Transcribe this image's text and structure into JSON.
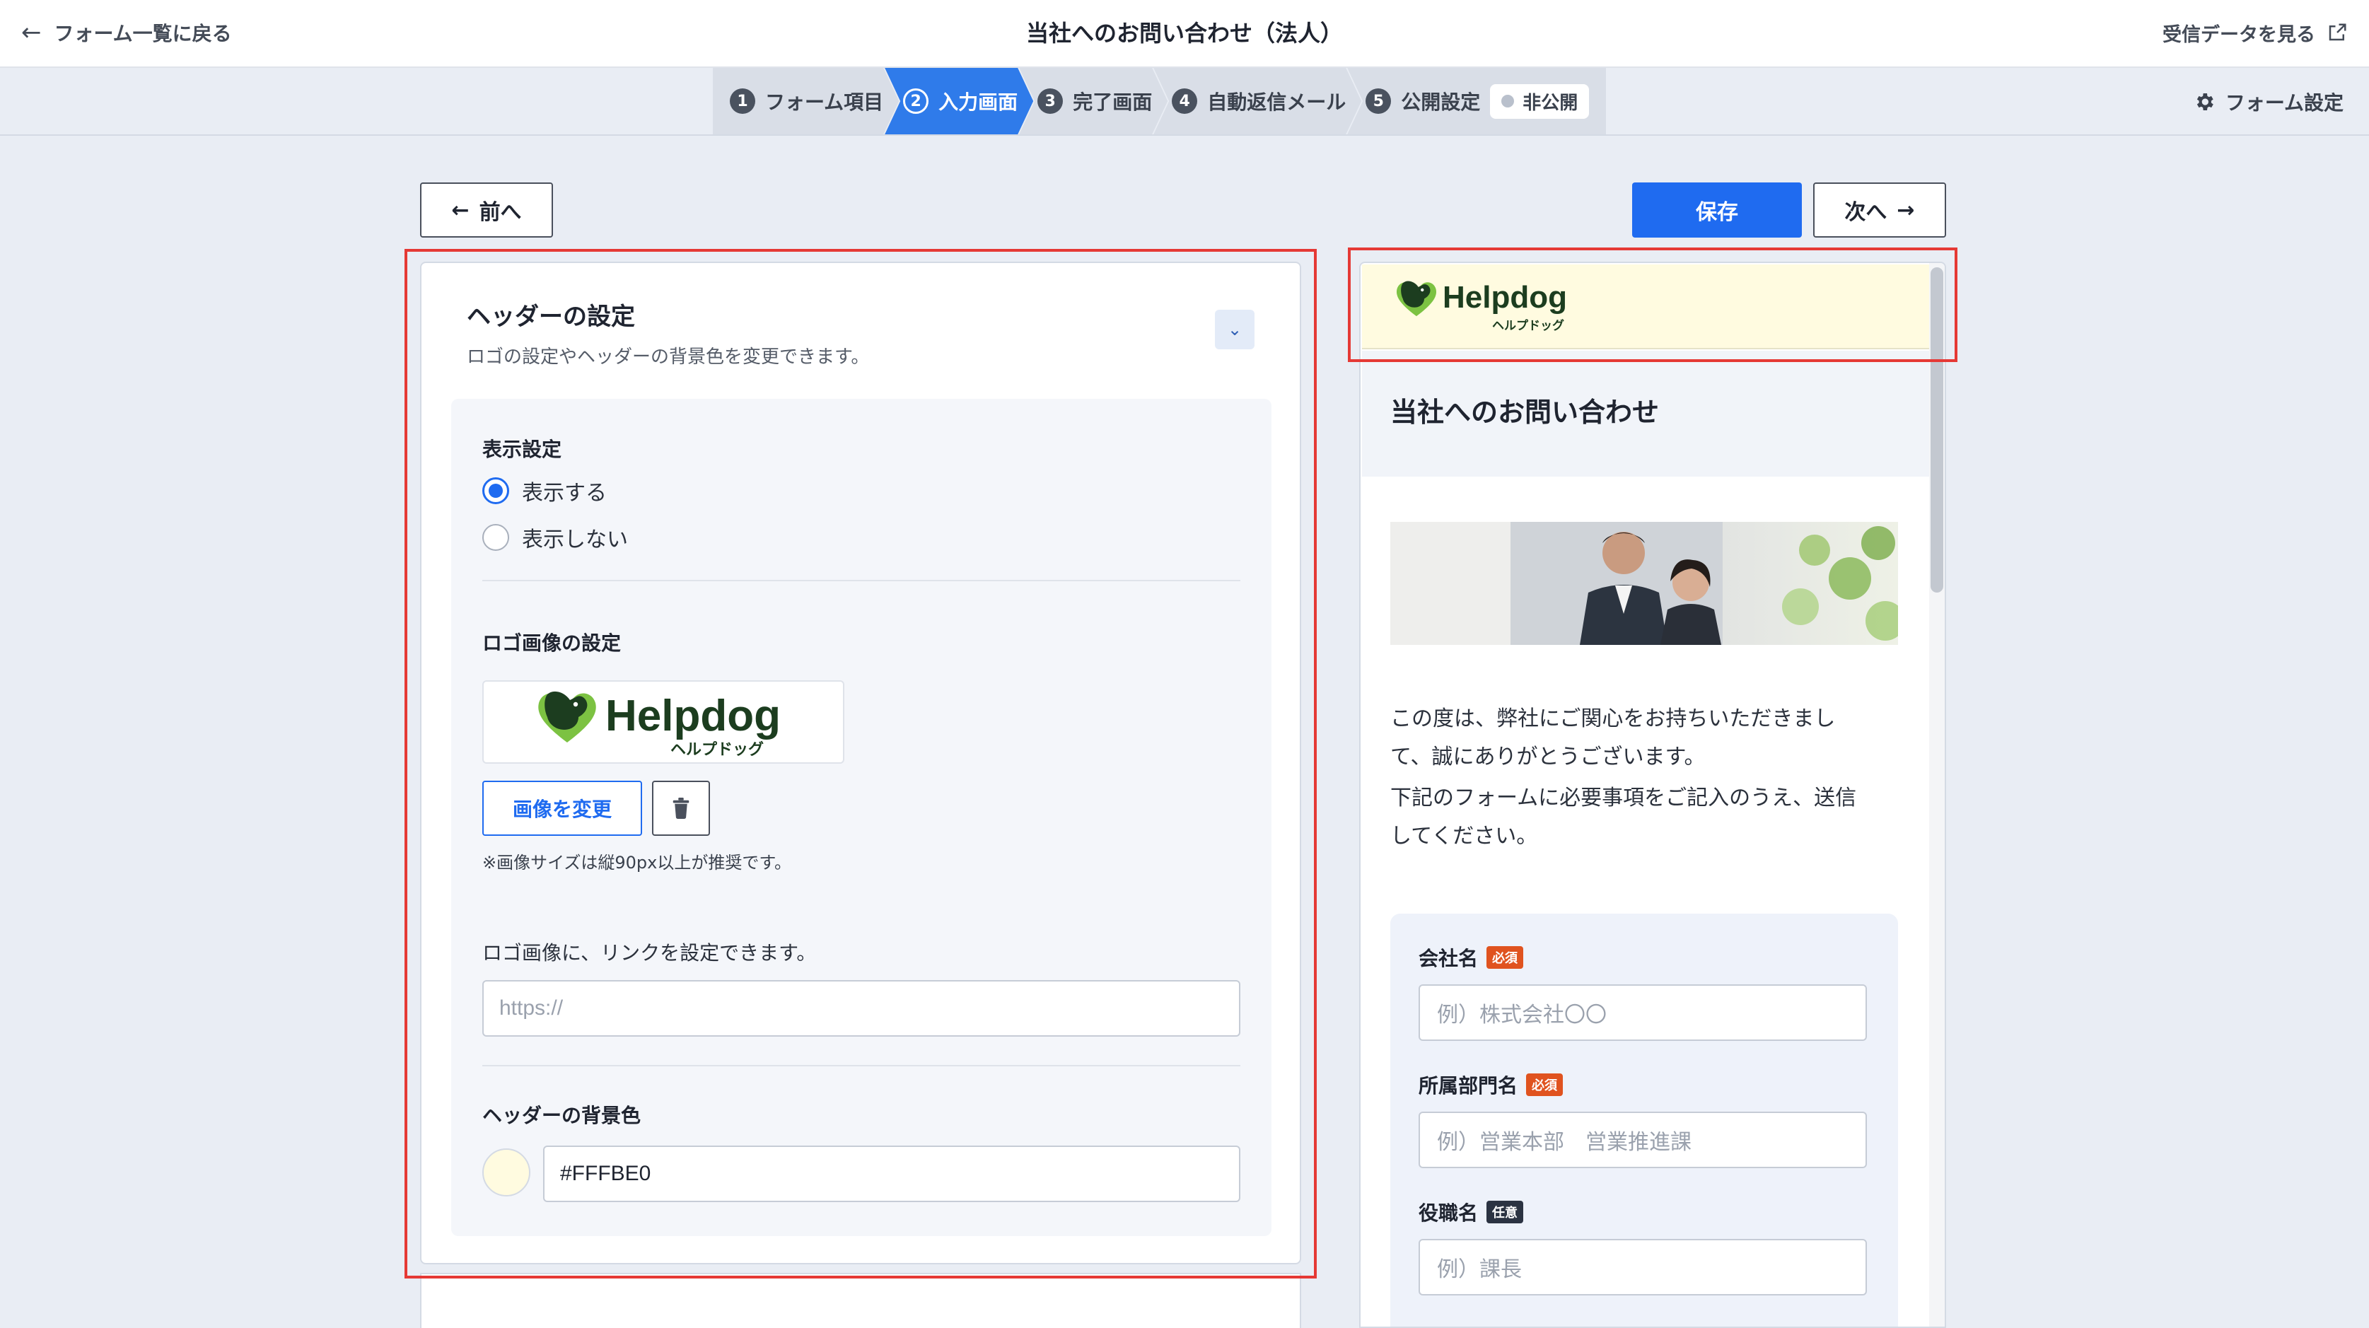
{
  "topbar": {
    "back_label": "フォーム一覧に戻る",
    "title": "当社へのお問い合わせ（法人）",
    "view_data_label": "受信データを見る"
  },
  "steps": [
    {
      "num": "1",
      "label": "フォーム項目"
    },
    {
      "num": "2",
      "label": "入力画面"
    },
    {
      "num": "3",
      "label": "完了画面"
    },
    {
      "num": "4",
      "label": "自動返信メール"
    },
    {
      "num": "5",
      "label": "公開設定"
    }
  ],
  "publish_status": "非公開",
  "form_settings_label": "フォーム設定",
  "actions": {
    "prev": "前へ",
    "save": "保存",
    "next": "次へ"
  },
  "header_settings": {
    "title": "ヘッダーの設定",
    "description": "ロゴの設定やヘッダーの背景色を変更できます。",
    "display_label": "表示設定",
    "option_show": "表示する",
    "option_hide": "表示しない",
    "logo_label": "ロゴ画像の設定",
    "change_image": "画像を変更",
    "size_note": "※画像サイズは縦90px以上が推奨です。",
    "link_note": "ロゴ画像に、リンクを設定できます。",
    "link_placeholder": "https://",
    "bg_label": "ヘッダーの背景色",
    "bg_value": "#FFFBE0"
  },
  "logo": {
    "name": "Helpdog",
    "sub": "ヘルプドッグ"
  },
  "preview": {
    "title": "当社へのお問い合わせ",
    "para1_line1": "この度は、弊社にご関心をお持ちいただきまし",
    "para1_line2": "て、誠にありがとうございます。",
    "para2_line1": "下記のフォームに必要事項をご記入のうえ、送信",
    "para2_line2": "してください。",
    "fields": [
      {
        "label": "会社名",
        "badge": "必須",
        "placeholder": "例）株式会社〇〇"
      },
      {
        "label": "所属部門名",
        "badge": "必須",
        "placeholder": "例）営業本部　営業推進課"
      },
      {
        "label": "役職名",
        "badge": "任意",
        "placeholder": "例）課長"
      }
    ]
  },
  "colors": {
    "accent": "#1f6bf0",
    "active_step": "#2f7bea",
    "highlight": "#e53935",
    "header_bg": "#FFFBE0"
  }
}
